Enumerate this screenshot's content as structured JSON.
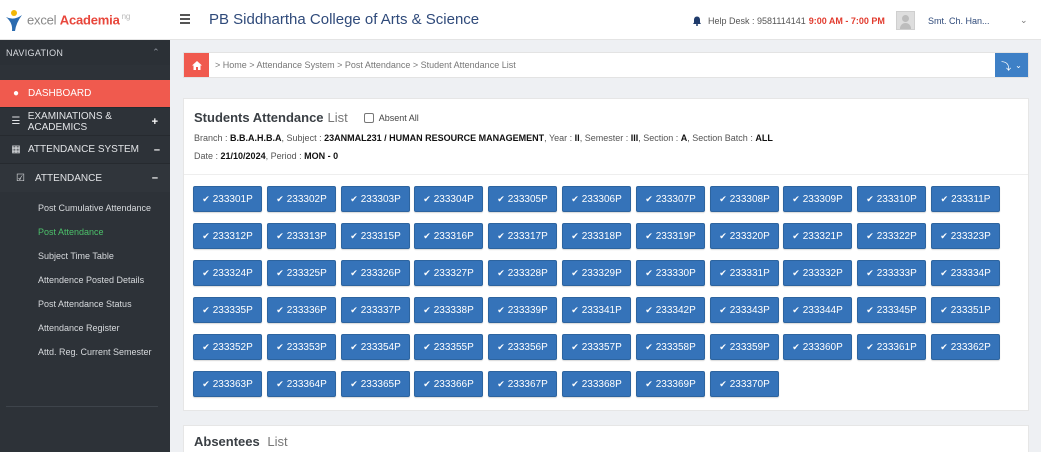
{
  "header": {
    "logo_prefix": "excel",
    "logo_brand": "Academia",
    "logo_suffix": "ng",
    "college": "PB Siddhartha College of Arts & Science",
    "helpdesk_label": "Help Desk : 9581114141",
    "helpdesk_time": "9:00 AM - 7:00 PM",
    "user": "Smt. Ch. Han..."
  },
  "sidebar": {
    "nav_label": "NAVIGATION",
    "dashboard": "DASHBOARD",
    "exams": "EXAMINATIONS & ACADEMICS",
    "attendance_system": "ATTENDANCE SYSTEM",
    "attendance": "ATTENDANCE",
    "subitems": [
      "Post Cumulative Attendance",
      "Post Attendance",
      "Subject Time Table",
      "Attendence Posted Details",
      "Post Attendance Status",
      "Attendance Register",
      "Attd. Reg. Current Semester"
    ]
  },
  "breadcrumb": "> Home > Attendance System > Post Attendance > Student Attendance List",
  "panel": {
    "title_bold": "Students Attendance",
    "title_light": "List",
    "absent_all": "Absent All",
    "branch_label": "Branch :",
    "branch": "B.B.A.H.B.A",
    "subject_label": ", Subject :",
    "subject": "23ANMAL231 / HUMAN RESOURCE MANAGEMENT",
    "year_label": ", Year :",
    "year": "II",
    "semester_label": ", Semester :",
    "semester": "III",
    "section_label": ", Section :",
    "section": "A",
    "batch_label": ", Section Batch :",
    "batch": "ALL",
    "date_label": "Date :",
    "date": "21/10/2024",
    "period_label": ", Period :",
    "period": "MON - 0"
  },
  "students": [
    "233301P",
    "233302P",
    "233303P",
    "233304P",
    "233305P",
    "233306P",
    "233307P",
    "233308P",
    "233309P",
    "233310P",
    "233311P",
    "233312P",
    "233313P",
    "233315P",
    "233316P",
    "233317P",
    "233318P",
    "233319P",
    "233320P",
    "233321P",
    "233322P",
    "233323P",
    "233324P",
    "233325P",
    "233326P",
    "233327P",
    "233328P",
    "233329P",
    "233330P",
    "233331P",
    "233332P",
    "233333P",
    "233334P",
    "233335P",
    "233336P",
    "233337P",
    "233338P",
    "233339P",
    "233341P",
    "233342P",
    "233343P",
    "233344P",
    "233345P",
    "233351P",
    "233352P",
    "233353P",
    "233354P",
    "233355P",
    "233356P",
    "233357P",
    "233358P",
    "233359P",
    "233360P",
    "233361P",
    "233362P",
    "233363P",
    "233364P",
    "233365P",
    "233366P",
    "233367P",
    "233368P",
    "233369P",
    "233370P"
  ],
  "absentees": {
    "title_bold": "Absentees",
    "title_light": "List"
  },
  "colors": {
    "accent": "#f05a4e",
    "button": "#3573b9",
    "sidebar": "#2d3238"
  }
}
